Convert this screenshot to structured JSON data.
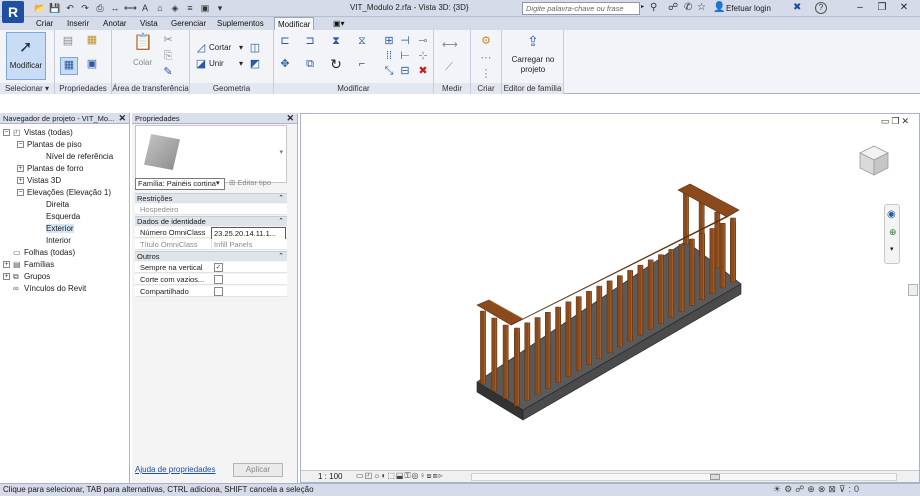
{
  "titlebar": {
    "app_logo": "R",
    "document_title": "VIT_Modulo 2.rfa - Vista 3D: {3D}",
    "search_placeholder": "Digite palavra-chave ou frase",
    "login_label": "Efetuar login",
    "help_label": "?"
  },
  "ribbon_tabs": [
    {
      "label": "Criar"
    },
    {
      "label": "Inserir"
    },
    {
      "label": "Anotar"
    },
    {
      "label": "Vista"
    },
    {
      "label": "Gerenciar"
    },
    {
      "label": "Suplementos"
    },
    {
      "label": "Modificar"
    }
  ],
  "ribbon": {
    "modify_button": "Modificar",
    "paste_label": "Colar",
    "cut_label": "Cortar",
    "join_label": "Unir",
    "load_project_label": "Carregar no projeto",
    "groups": {
      "select": "Selecionar",
      "properties": "Propriedades",
      "clipboard": "Área de transferência",
      "geometry": "Geometria",
      "modify": "Modificar",
      "measure": "Medir",
      "create": "Criar",
      "family_editor": "Editor de família"
    }
  },
  "project_browser": {
    "title": "Navegador de projeto - VIT_Mo...",
    "items": [
      {
        "label": "Vistas (todas)",
        "toggle": "−"
      },
      {
        "label": "Plantas de piso",
        "toggle": "−"
      },
      {
        "label": "Nível de referência",
        "toggle": ""
      },
      {
        "label": "Plantas de forro",
        "toggle": "+"
      },
      {
        "label": "Vistas 3D",
        "toggle": "+"
      },
      {
        "label": "Elevações (Elevação 1)",
        "toggle": "−"
      },
      {
        "label": "Direita",
        "toggle": ""
      },
      {
        "label": "Esquerda",
        "toggle": ""
      },
      {
        "label": "Exterior",
        "toggle": ""
      },
      {
        "label": "Interior",
        "toggle": ""
      },
      {
        "label": "Folhas (todas)",
        "toggle": ""
      },
      {
        "label": "Famílias",
        "toggle": "+"
      },
      {
        "label": "Grupos",
        "toggle": "+"
      },
      {
        "label": "Vínculos do Revit",
        "toggle": ""
      }
    ]
  },
  "properties": {
    "title": "Propriedades",
    "type_selector": "Família: Painéis cortina",
    "edit_type": "Editar tipo",
    "sections": {
      "constraints": "Restrições",
      "identity": "Dados de identidade",
      "other": "Outros"
    },
    "rows": {
      "host": {
        "key": "Hospedeiro",
        "value": ""
      },
      "omni_number": {
        "key": "Número OmniClass",
        "value": "23.25.20.14.11.1..."
      },
      "omni_title": {
        "key": "Título OmniClass",
        "value": "Infill Panels"
      },
      "always_vertical": {
        "key": "Sempre na vertical",
        "checked": true
      },
      "cut_with_voids": {
        "key": "Corte com vazios...",
        "checked": false
      },
      "shared": {
        "key": "Compartilhado",
        "checked": false
      }
    },
    "help_link": "Ajuda de propriedades",
    "apply_button": "Aplicar"
  },
  "viewport": {
    "scale": "1 : 100",
    "wood_color": "#8a4a1c",
    "base_color": "#4b4b4b"
  },
  "status": {
    "text": "Clique para selecionar, TAB para alternativas, CTRL adiciona, SHIFT cancela a seleção"
  }
}
